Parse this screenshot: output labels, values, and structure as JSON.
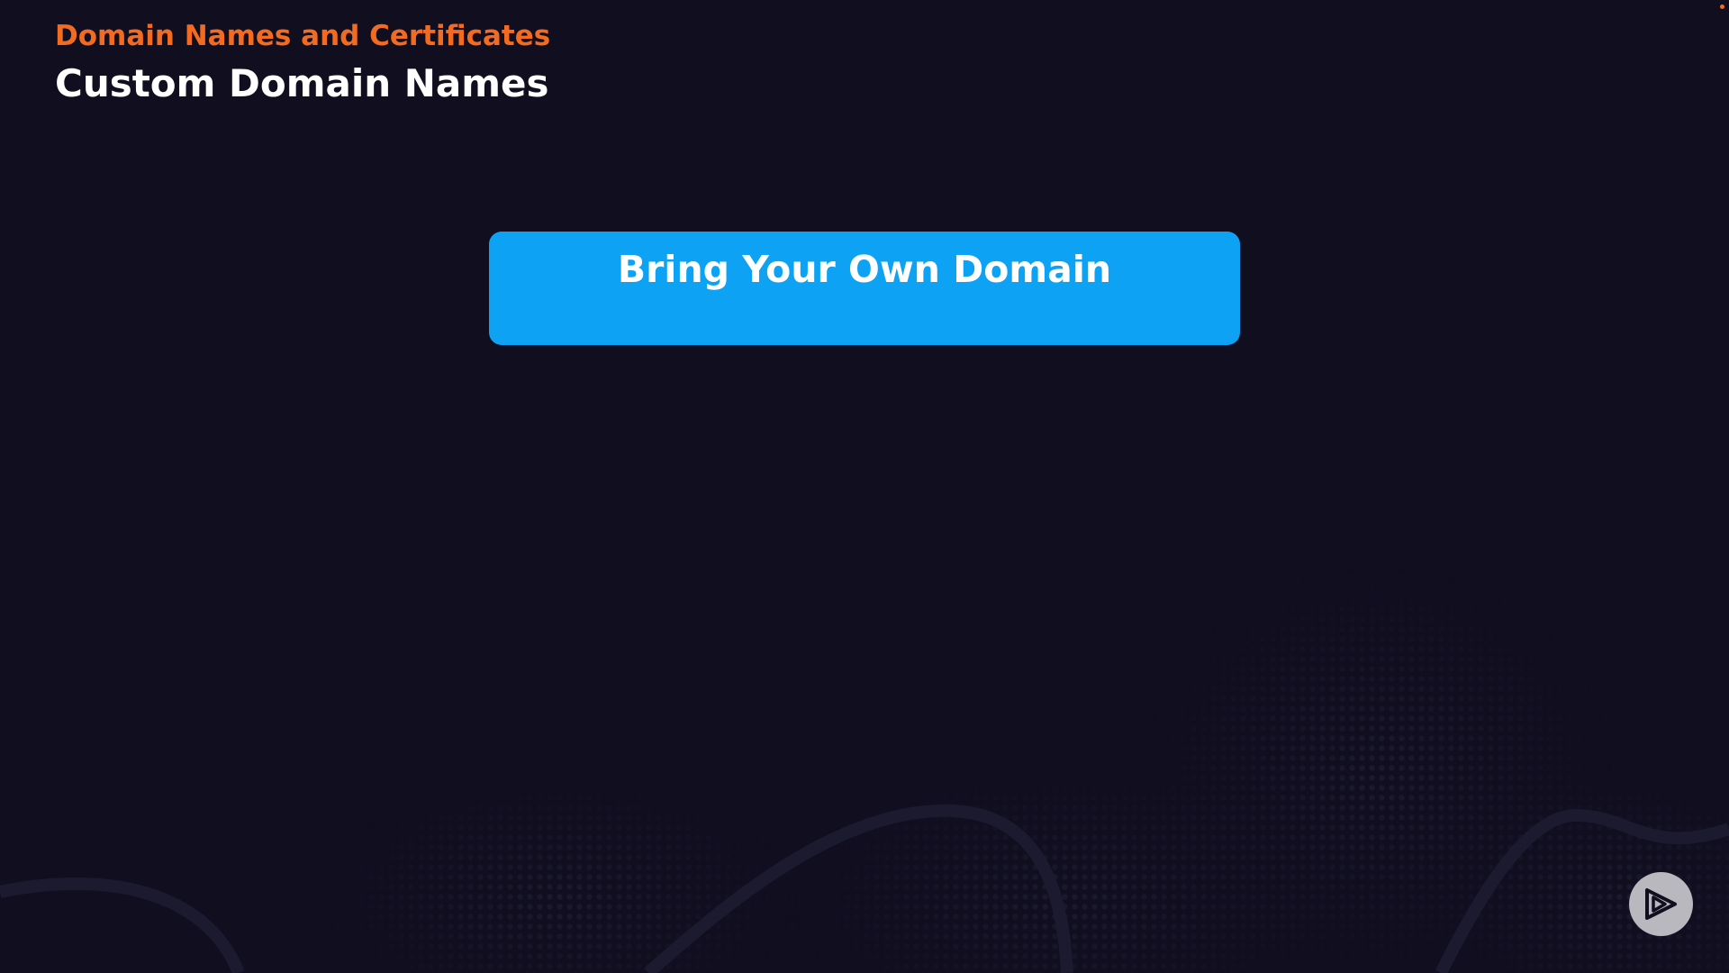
{
  "header": {
    "section_label": "Domain Names and Certificates",
    "title": "Custom Domain Names"
  },
  "main": {
    "callout_text": "Bring Your Own Domain"
  },
  "controls": {
    "play_icon": "play-logo-icon"
  },
  "colors": {
    "background": "#100e1f",
    "accent_orange": "#f26b21",
    "callout_blue": "#0ea2f5",
    "title_white": "#ffffff",
    "play_button_gray": "#b9b8bf"
  }
}
